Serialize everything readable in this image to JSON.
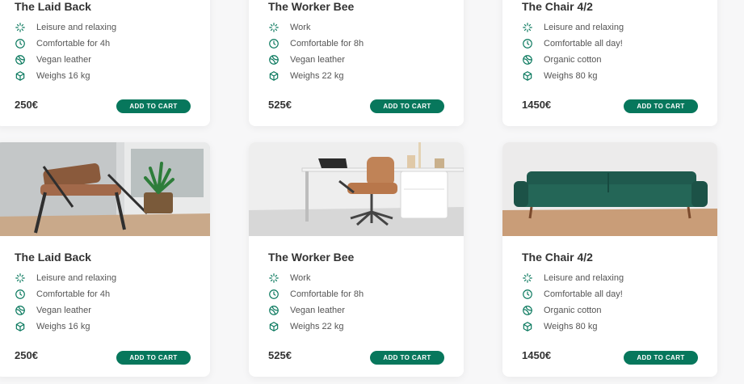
{
  "products": [
    {
      "name": "The Laid Back",
      "features": [
        "Leisure and relaxing",
        "Comfortable for 4h",
        "Vegan leather",
        "Weighs 16 kg"
      ],
      "price": "250€",
      "cta": "ADD TO CART"
    },
    {
      "name": "The Worker Bee",
      "features": [
        "Work",
        "Comfortable for 8h",
        "Vegan leather",
        "Weighs 22 kg"
      ],
      "price": "525€",
      "cta": "ADD TO CART"
    },
    {
      "name": "The Chair 4/2",
      "features": [
        "Leisure and relaxing",
        "Comfortable all day!",
        "Organic cotton",
        "Weighs 80 kg"
      ],
      "price": "1450€",
      "cta": "ADD TO CART"
    }
  ],
  "feature_icons": [
    "activity-icon",
    "clock-icon",
    "leaf-icon",
    "box-icon"
  ],
  "colors": {
    "accent": "#07775c",
    "text": "#333333",
    "background": "#f7f7f8"
  }
}
